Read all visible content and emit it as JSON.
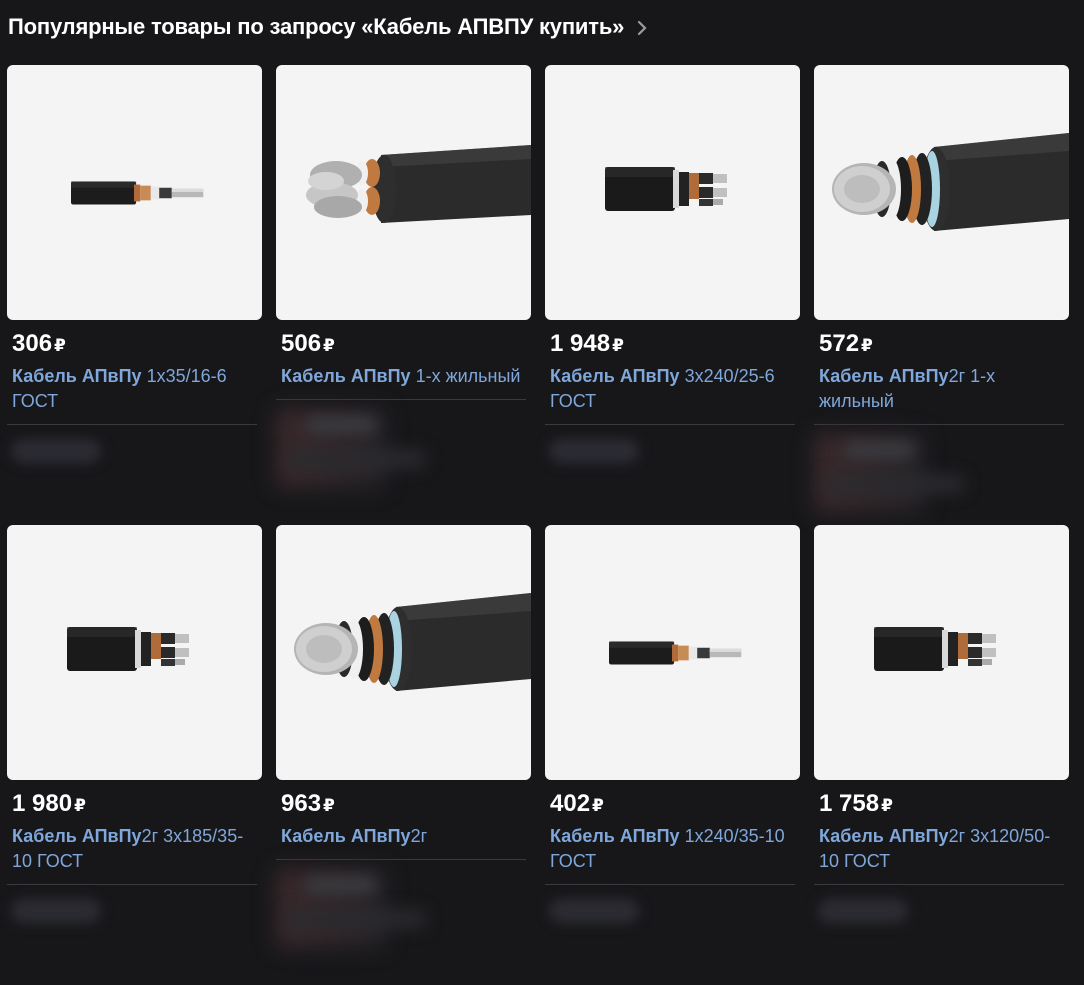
{
  "header": {
    "title": "Популярные товары по запросу «Кабель АПВПУ купить»"
  },
  "currency": "₽",
  "products": [
    {
      "price": "306",
      "brand": "Кабель АПвПу",
      "rest": " 1х35/16-6 ГОСТ",
      "image": "cable-small",
      "seller_blur": "short"
    },
    {
      "price": "506",
      "brand": "Кабель АПвПу",
      "rest": " 1-х жильный",
      "image": "cable-closeup-3",
      "seller_blur": "tall"
    },
    {
      "price": "1 948",
      "brand": "Кабель АПвПу",
      "rest": " 3х240/25-6 ГОСТ",
      "image": "cable-small-3",
      "seller_blur": "short"
    },
    {
      "price": "572",
      "brand": "Кабель АПвПу",
      "rest": "2г 1-х жильный",
      "image": "cable-closeup-1",
      "seller_blur": "tall"
    },
    {
      "price": "1 980",
      "brand": "Кабель АПвПу",
      "rest": "2г 3х185/35-10 ГОСТ",
      "image": "cable-small-3",
      "seller_blur": "short"
    },
    {
      "price": "963",
      "brand": "Кабель АПвПу",
      "rest": "2г",
      "image": "cable-closeup-1",
      "seller_blur": "tall"
    },
    {
      "price": "402",
      "brand": "Кабель АПвПу",
      "rest": " 1х240/35-10 ГОСТ",
      "image": "cable-small",
      "seller_blur": "short"
    },
    {
      "price": "1 758",
      "brand": "Кабель АПвПу",
      "rest": "2г 3х120/50-10 ГОСТ",
      "image": "cable-small-3",
      "seller_blur": "short"
    }
  ]
}
